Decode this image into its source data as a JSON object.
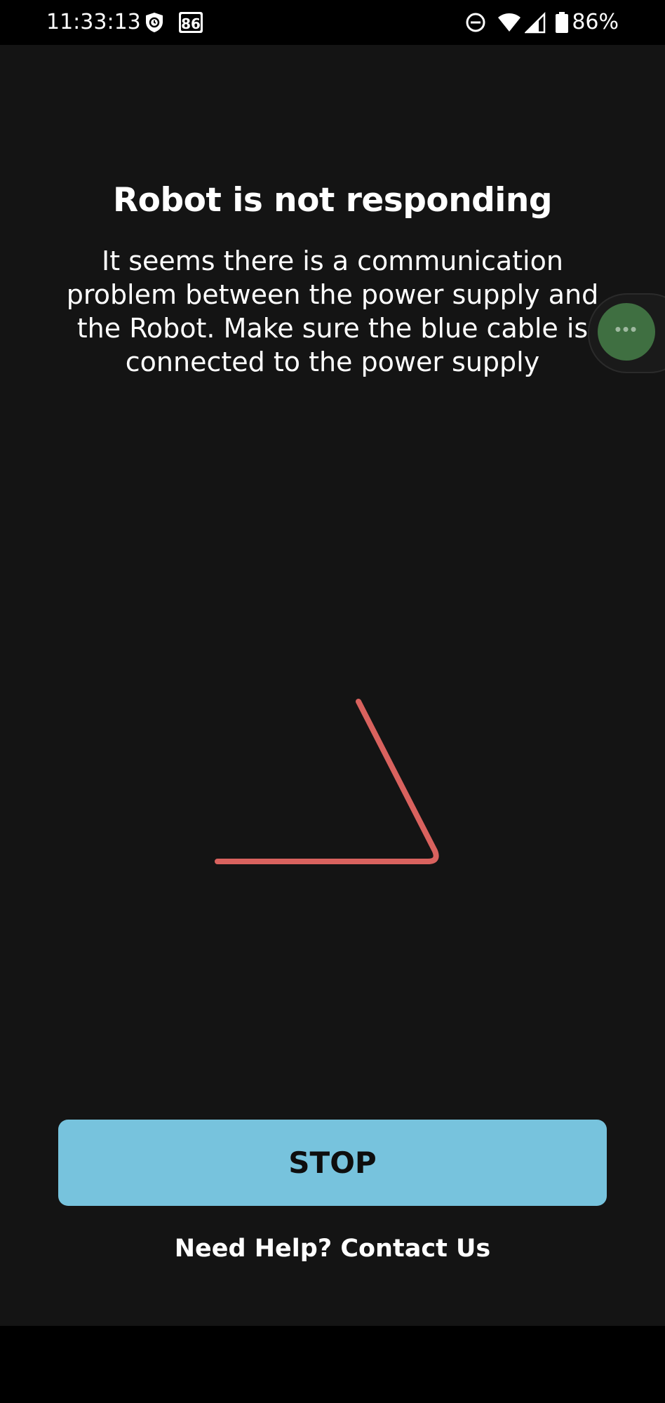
{
  "status_bar": {
    "time": "11:33:13",
    "notification_badge": "86",
    "battery": "86%",
    "icons": [
      "shield-icon",
      "badge-icon",
      "do-not-disturb-icon",
      "wifi-icon",
      "signal-icon",
      "battery-icon"
    ]
  },
  "dialog": {
    "title": "Robot is not responding",
    "message": "It seems there is a communication problem between the power supply and the Robot. Make sure the blue cable is connected to the power supply",
    "spinner_color": "#d9625e"
  },
  "floating_bubble": {
    "icon": "more-dots-icon",
    "dots": "•••",
    "color": "#3f6f41"
  },
  "actions": {
    "stop_label": "STOP",
    "stop_color": "#77c3dd",
    "help_label": "Need Help? Contact Us"
  }
}
